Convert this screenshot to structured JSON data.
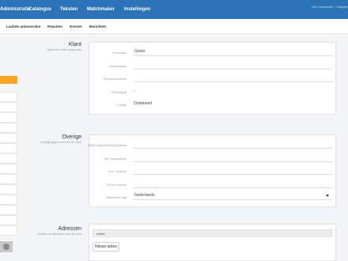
{
  "topnav": {
    "items": [
      "Administratie",
      "Catalogus",
      "Teksten",
      "Matchmaker",
      "Instellingen"
    ],
    "user": "Vita Onderzoek / Ontagkrt"
  },
  "subnav": {
    "items": [
      "Laatste antwoorden",
      "Reacties",
      "Keuren",
      "Berichten"
    ]
  },
  "sidebar": {
    "button_color": "#f5a623"
  },
  "klant": {
    "title": "Klant",
    "subtitle": "Algemene klant gegevens",
    "fields": [
      {
        "label": "Voornaam",
        "value": "Gieter"
      },
      {
        "label": "Achternaam",
        "value": ""
      },
      {
        "label": "Telefoonnummer",
        "value": ""
      },
      {
        "label": "Profieltype",
        "value": "-"
      },
      {
        "label": "Leeftijd",
        "value": "Onbekend"
      }
    ]
  },
  "overige": {
    "title": "Overige",
    "subtitle": "Overige gegevens van de klant",
    "fields": [
      {
        "label": "IBAN bankrekeningnummer",
        "value": ""
      },
      {
        "label": "BIC (bankcode)",
        "value": ""
      },
      {
        "label": "KvK nummer",
        "value": ""
      },
      {
        "label": "BTW nummer",
        "value": ""
      },
      {
        "label": "Standaard taal",
        "value": "Nederlands"
      }
    ]
  },
  "adressen": {
    "title": "Adressen",
    "subtitle": "Beheer de adressen van de klant",
    "table_header": "Adres",
    "new_button": "Nieuw adres"
  },
  "colors": {
    "topbar": "#2b73b6",
    "accent": "#f5a623"
  }
}
